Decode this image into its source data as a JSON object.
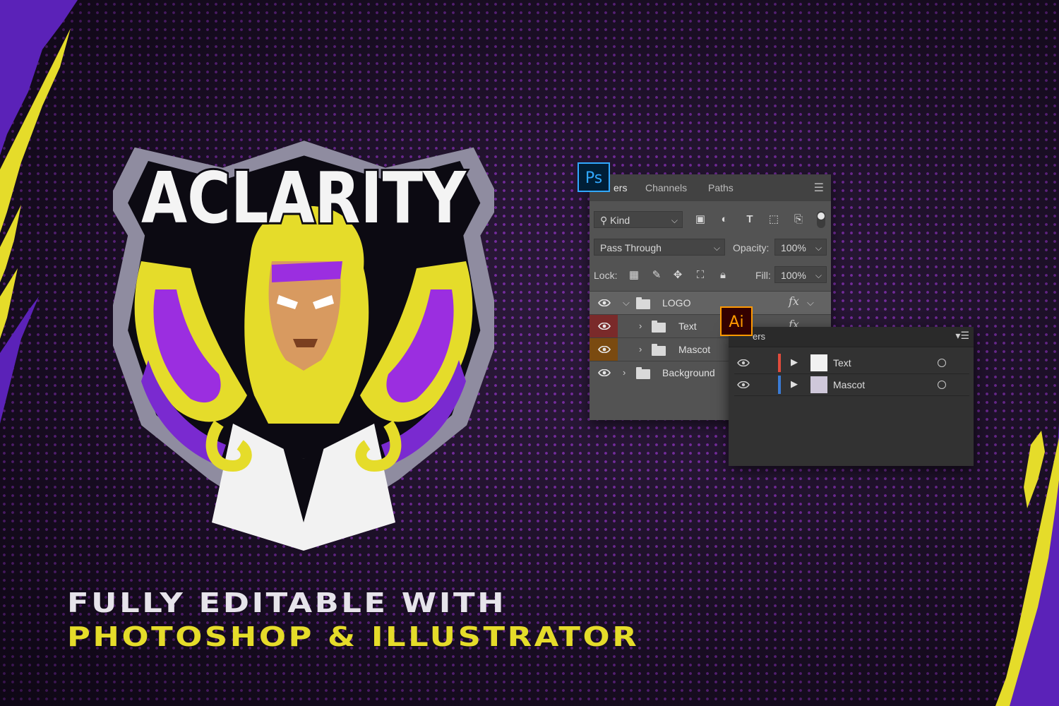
{
  "colors": {
    "accent_yellow": "#e5dc2a",
    "accent_purple": "#9b2ee0",
    "background": "#1e1129",
    "ps_blue": "#31a8ff",
    "ai_orange": "#ff9a00"
  },
  "logo": {
    "brand_text": "ACLARITY"
  },
  "caption": {
    "line1": "FULLY EDITABLE WITH",
    "line2": "PHOTOSHOP & ILLUSTRATOR"
  },
  "photoshop": {
    "badge": "Ps",
    "tabs": [
      "ers",
      "Channels",
      "Paths"
    ],
    "filter_kind": "Kind",
    "blend_mode": "Pass Through",
    "opacity_label": "Opacity:",
    "opacity_value": "100%",
    "lock_label": "Lock:",
    "fill_label": "Fill:",
    "fill_value": "100%",
    "layers": [
      {
        "name": "LOGO",
        "fx": "fx",
        "eye_color": "#535353"
      },
      {
        "name": "Text",
        "fx": "fx",
        "eye_color": "#7a2a2a"
      },
      {
        "name": "Mascot",
        "fx": "",
        "eye_color": "#7a4a10"
      },
      {
        "name": "Background",
        "fx": "",
        "eye_color": "#535353"
      }
    ]
  },
  "illustrator": {
    "badge": "Ai",
    "header": "ers",
    "layers": [
      {
        "name": "Text",
        "color": "#e04b3c"
      },
      {
        "name": "Mascot",
        "color": "#3a7bd5"
      }
    ]
  }
}
